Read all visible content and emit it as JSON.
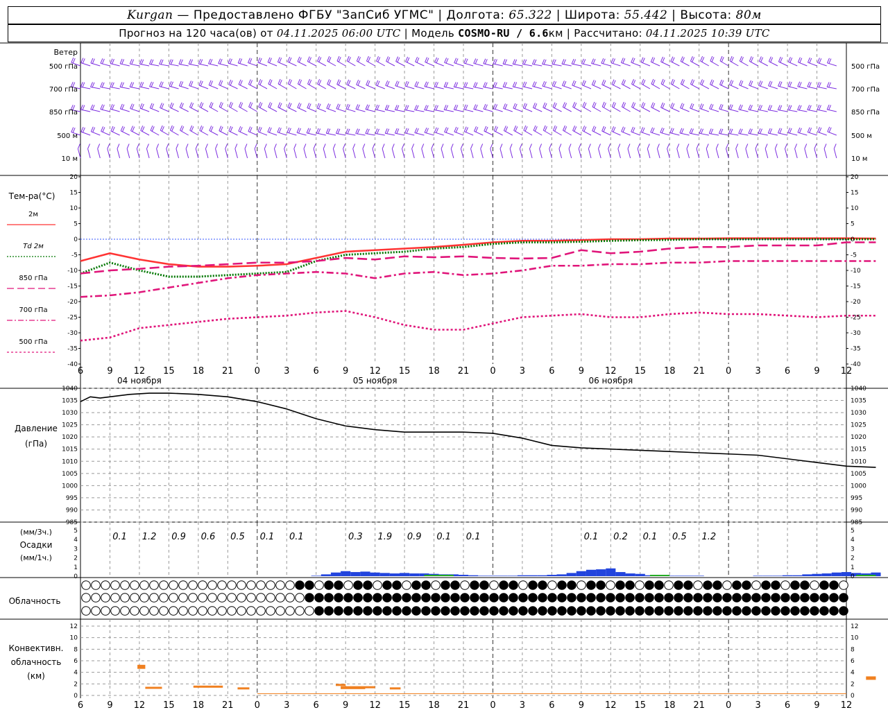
{
  "header": {
    "city": "Kurgan",
    "dash": " — ",
    "provider": "Предоставлено ФГБУ \"ЗапСиб УГМС\"",
    "sep": " | ",
    "lon_label": "Долгота: ",
    "lon_value": "65.322",
    "lat_label": "Широта: ",
    "lat_value": "55.442",
    "alt_label": "Высота: ",
    "alt_value": "80м",
    "fc_label": "Прогноз на 120 часа(ов) от ",
    "fc_date": "04.11.2025 06:00 UTC",
    "model_label": "Модель ",
    "model_name": "COSMO-RU / 6.6",
    "model_unit": "км",
    "calc_label": "Рассчитано: ",
    "calc_date": "04.11.2025 10:39 UTC"
  },
  "x_ticks": [
    "6",
    "9",
    "12",
    "15",
    "18",
    "21",
    "0",
    "3",
    "6",
    "9",
    "12",
    "15",
    "18",
    "21",
    "0",
    "3",
    "6",
    "9",
    "12",
    "15",
    "18",
    "21",
    "0",
    "3",
    "6",
    "9",
    "12"
  ],
  "date_labels": [
    "04 ноября",
    "05 ноября",
    "06 ноября"
  ],
  "colors": {
    "wind": "#7b2be0",
    "t2m": "#ff3333",
    "td2m": "#007700",
    "t850": "#e0157a",
    "pressure": "#000000",
    "precip_3h": "#2244dd",
    "precip_1h": "#22aa22",
    "convective": "#f08020",
    "grid": "#999999"
  },
  "wind_panel": {
    "title": "Ветер",
    "levels": [
      "500 гПа",
      "700 гПа",
      "850 гПа",
      "500 м",
      "10  м"
    ]
  },
  "temp_panel": {
    "title": "Тем-ра(°C)",
    "legend": [
      {
        "label": "2м",
        "style": "solid"
      },
      {
        "label": "Td  2м",
        "style": "dotted"
      },
      {
        "label": "850 гПа",
        "style": "dash"
      },
      {
        "label": "700 гПа",
        "style": "dashdot"
      },
      {
        "label": "500 гПа",
        "style": "dot"
      }
    ],
    "y_ticks": [
      "20",
      "15",
      "10",
      "5",
      "0",
      "-5",
      "-10",
      "-15",
      "-20",
      "-25",
      "-30",
      "-35",
      "-40"
    ]
  },
  "pressure_panel": {
    "title1": "Давление",
    "title2": "(гПа)",
    "y_ticks": [
      "1040",
      "1035",
      "1030",
      "1025",
      "1020",
      "1015",
      "1010",
      "1005",
      "1000",
      "995",
      "990",
      "985"
    ]
  },
  "precip_panel": {
    "label1": "(мм/3ч.)",
    "label2": "Осадки",
    "label3": "(мм/1ч.)",
    "y_ticks": [
      "5",
      "4",
      "3",
      "2",
      "1",
      "0"
    ],
    "totals": [
      {
        "h": 6,
        "v": "0.1"
      },
      {
        "h": 9,
        "v": "1.2"
      },
      {
        "h": 12,
        "v": "0.9"
      },
      {
        "h": 15,
        "v": "0.6"
      },
      {
        "h": 18,
        "v": "0.5"
      },
      {
        "h": 21,
        "v": "0.1"
      },
      {
        "h": 24,
        "v": "0.1"
      },
      {
        "h": 30,
        "v": "0.3"
      },
      {
        "h": 33,
        "v": "1.9"
      },
      {
        "h": 36,
        "v": "0.9"
      },
      {
        "h": 39,
        "v": "0.1"
      },
      {
        "h": 42,
        "v": "0.1"
      },
      {
        "h": 54,
        "v": "0.1"
      },
      {
        "h": 57,
        "v": "0.2"
      },
      {
        "h": 60,
        "v": "0.1"
      },
      {
        "h": 63,
        "v": "0.5"
      },
      {
        "h": 66,
        "v": "1.2"
      }
    ]
  },
  "cloud_panel": {
    "title": "Облачность"
  },
  "conv_panel": {
    "title1": "Конвективн.",
    "title2": "облачность",
    "title3": "(км)",
    "y_ticks": [
      "12",
      "10",
      "8",
      "6",
      "4",
      "2",
      "0"
    ]
  },
  "chart_data": {
    "type": "line",
    "x_unit": "hours from 04.11.2025 06:00 UTC",
    "temperature": {
      "ylim": [
        -40,
        20
      ],
      "series": [
        {
          "name": "2м",
          "x": [
            0,
            3,
            6,
            9,
            12,
            15,
            18,
            21,
            24,
            27,
            30,
            33,
            36,
            39,
            42,
            45,
            48,
            51,
            54,
            57,
            60,
            63,
            66,
            69,
            72,
            75,
            78,
            81
          ],
          "values": [
            -7.0,
            -4.5,
            -6.5,
            -8.0,
            -8.8,
            -8.8,
            -8.5,
            -8.0,
            -6.0,
            -4.0,
            -3.5,
            -3.0,
            -2.5,
            -1.8,
            -1.0,
            -0.5,
            -0.5,
            -0.3,
            0.0,
            0.0,
            0.2,
            0.2,
            0.3,
            0.3,
            0.3,
            0.3,
            0.3,
            0.2
          ]
        },
        {
          "name": "Td  2м",
          "x": [
            0,
            3,
            6,
            9,
            12,
            15,
            18,
            21,
            24,
            27,
            30,
            33,
            36,
            39,
            42,
            45,
            48,
            51,
            54,
            57,
            60,
            63,
            66,
            69,
            72,
            75,
            78,
            81
          ],
          "values": [
            -11.0,
            -7.5,
            -10.0,
            -12.0,
            -12.0,
            -11.5,
            -11.0,
            -10.5,
            -7.0,
            -5.0,
            -4.5,
            -4.0,
            -3.0,
            -2.5,
            -1.5,
            -1.0,
            -1.0,
            -0.8,
            -0.5,
            -0.3,
            -0.2,
            0.0,
            0.0,
            0.0,
            0.0,
            0.0,
            0.0,
            0.0
          ]
        },
        {
          "name": "850 гПа",
          "x": [
            0,
            3,
            6,
            9,
            12,
            15,
            18,
            21,
            24,
            27,
            30,
            33,
            36,
            39,
            42,
            45,
            48,
            51,
            54,
            57,
            60,
            63,
            66,
            69,
            72,
            75,
            78,
            81
          ],
          "values": [
            -11.0,
            -10.0,
            -9.5,
            -8.8,
            -8.5,
            -8.0,
            -7.5,
            -7.5,
            -7.0,
            -6.0,
            -6.5,
            -5.5,
            -5.8,
            -5.5,
            -6.0,
            -6.2,
            -6.0,
            -3.5,
            -4.5,
            -4.0,
            -3.0,
            -2.5,
            -2.5,
            -2.0,
            -2.0,
            -2.0,
            -1.0,
            -1.0
          ]
        },
        {
          "name": "700 гПа",
          "x": [
            0,
            3,
            6,
            9,
            12,
            15,
            18,
            21,
            24,
            27,
            30,
            33,
            36,
            39,
            42,
            45,
            48,
            51,
            54,
            57,
            60,
            63,
            66,
            69,
            72,
            75,
            78,
            81
          ],
          "values": [
            -18.5,
            -18.0,
            -17.0,
            -15.5,
            -14.0,
            -12.5,
            -11.5,
            -11.0,
            -10.5,
            -11.0,
            -12.5,
            -11.0,
            -10.5,
            -11.5,
            -11.0,
            -10.0,
            -8.5,
            -8.5,
            -8.0,
            -8.0,
            -7.5,
            -7.5,
            -7.0,
            -7.0,
            -7.0,
            -7.0,
            -7.0,
            -7.0
          ]
        },
        {
          "name": "500 гПа",
          "x": [
            0,
            3,
            6,
            9,
            12,
            15,
            18,
            21,
            24,
            27,
            30,
            33,
            36,
            39,
            42,
            45,
            48,
            51,
            54,
            57,
            60,
            63,
            66,
            69,
            72,
            75,
            78,
            81
          ],
          "values": [
            -32.5,
            -31.5,
            -28.5,
            -27.5,
            -26.5,
            -25.5,
            -25.0,
            -24.5,
            -23.5,
            -23.0,
            -25.0,
            -27.5,
            -29.0,
            -29.0,
            -27.0,
            -25.0,
            -24.5,
            -24.0,
            -25.0,
            -25.0,
            -24.0,
            -23.5,
            -24.0,
            -24.0,
            -24.5,
            -25.0,
            -24.5,
            -24.5
          ]
        }
      ]
    },
    "pressure": {
      "ylim": [
        985,
        1040
      ],
      "x": [
        0,
        1,
        2,
        3,
        5,
        7,
        9,
        12,
        15,
        18,
        21,
        24,
        27,
        30,
        33,
        36,
        39,
        42,
        45,
        48,
        51,
        54,
        57,
        60,
        63,
        66,
        69,
        72,
        75,
        78,
        81
      ],
      "values": [
        1034.5,
        1036.5,
        1036.0,
        1036.5,
        1037.5,
        1038.0,
        1038.0,
        1037.5,
        1036.5,
        1034.5,
        1031.5,
        1027.5,
        1024.5,
        1023.0,
        1022.0,
        1022.0,
        1022.0,
        1021.5,
        1019.5,
        1016.5,
        1015.5,
        1015.0,
        1014.5,
        1014.0,
        1013.5,
        1013.0,
        1012.5,
        1011.0,
        1009.5,
        1008.0,
        1007.5
      ]
    },
    "precip_3h": {
      "ylim": [
        0,
        5
      ],
      "x": [
        24,
        25,
        26,
        27,
        28,
        29,
        30,
        31,
        32,
        33,
        34,
        35,
        36,
        37,
        38,
        39,
        40,
        41,
        42,
        43,
        44,
        45,
        46,
        47,
        48,
        49,
        50,
        51,
        52,
        53,
        54,
        55,
        56,
        57,
        58,
        59,
        60,
        61,
        62,
        63,
        64,
        65,
        66,
        67,
        68,
        69,
        70,
        71,
        72,
        73,
        74,
        75,
        76,
        77,
        78,
        79,
        80,
        81
      ],
      "values": [
        0.05,
        0.2,
        0.4,
        0.55,
        0.45,
        0.5,
        0.4,
        0.35,
        0.3,
        0.35,
        0.3,
        0.3,
        0.25,
        0.2,
        0.2,
        0.15,
        0.1,
        0.05,
        0.05,
        0.05,
        0.05,
        0.1,
        0.1,
        0.1,
        0.15,
        0.2,
        0.35,
        0.55,
        0.7,
        0.75,
        0.85,
        0.45,
        0.3,
        0.25,
        0.1,
        0.05,
        0.05,
        0.05,
        0.05,
        0.05,
        0,
        0,
        0,
        0,
        0,
        0.05,
        0.05,
        0.05,
        0.1,
        0.1,
        0.2,
        0.25,
        0.3,
        0.4,
        0.45,
        0.35,
        0.3,
        0.4
      ]
    },
    "precip_1h_series_name": "(мм/1ч.)",
    "convective_cloud_km": [
      {
        "x0": 5.8,
        "x1": 6.6,
        "base": 4.6,
        "top": 5.3
      },
      {
        "x0": 6.6,
        "x1": 8.3,
        "base": 1.2,
        "top": 1.5
      },
      {
        "x0": 11.5,
        "x1": 14.5,
        "base": 1.4,
        "top": 1.7
      },
      {
        "x0": 16.0,
        "x1": 17.2,
        "base": 1.1,
        "top": 1.4
      },
      {
        "x0": 26.0,
        "x1": 27.0,
        "base": 1.7,
        "top": 2.0
      },
      {
        "x0": 26.5,
        "x1": 29.0,
        "base": 1.1,
        "top": 1.6
      },
      {
        "x0": 29.0,
        "x1": 30.0,
        "base": 1.3,
        "top": 1.6
      },
      {
        "x0": 31.5,
        "x1": 32.6,
        "base": 1.1,
        "top": 1.4
      },
      {
        "x0": 80.0,
        "x1": 81.0,
        "base": 2.7,
        "top": 3.3
      }
    ],
    "cloud_cover_octas": {
      "low": [
        0,
        0,
        0,
        0,
        0,
        0,
        0,
        0,
        0,
        0,
        0,
        0,
        0,
        0,
        0,
        0,
        0,
        0,
        0,
        0,
        0,
        0,
        0,
        0,
        0,
        0,
        0,
        0,
        0,
        0,
        0,
        0,
        0,
        0,
        0,
        0,
        0,
        0,
        0,
        0,
        0,
        0,
        0,
        0,
        0,
        0,
        0,
        0,
        0,
        0,
        0,
        0,
        0,
        0,
        0,
        0,
        0,
        0,
        0,
        0,
        0,
        0,
        0,
        0,
        0,
        0,
        0,
        0,
        0,
        0,
        0,
        0,
        0,
        0,
        0,
        0,
        0,
        0,
        0,
        0,
        0,
        0
      ],
      "mid": [
        0,
        0,
        0,
        0,
        0,
        0,
        0,
        0,
        0,
        0,
        0,
        0,
        0,
        0,
        0,
        0,
        0,
        0,
        0,
        0,
        0,
        0,
        0,
        0,
        0,
        0,
        0,
        0,
        0,
        0,
        0,
        0,
        0,
        0,
        0,
        0,
        0,
        0,
        0,
        0,
        0,
        0,
        0,
        0,
        0,
        0,
        0,
        0,
        0,
        0,
        0,
        0,
        0,
        0,
        0,
        0,
        0,
        0,
        0,
        0,
        0,
        0,
        0,
        0,
        0,
        0,
        0,
        0,
        0,
        0,
        0,
        0,
        0,
        0,
        0,
        0,
        0,
        0,
        0,
        0,
        0,
        0
      ],
      "high": [
        0,
        0,
        0,
        0,
        0,
        0,
        0,
        0,
        0,
        0,
        0,
        0,
        0,
        0,
        0,
        0,
        0,
        0,
        0,
        0,
        0,
        0,
        0,
        0,
        0,
        0,
        0,
        0,
        0,
        0,
        0,
        0,
        0,
        0,
        0,
        0,
        0,
        0,
        0,
        0,
        0,
        0,
        0,
        0,
        0,
        0,
        0,
        0,
        0,
        0,
        0,
        0,
        0,
        0,
        0,
        0,
        0,
        0,
        0,
        0,
        0,
        0,
        0,
        0,
        0,
        0,
        0,
        0,
        0,
        0,
        0,
        0,
        0,
        0,
        0,
        0,
        0,
        0,
        0,
        0,
        0,
        0
      ]
    }
  }
}
